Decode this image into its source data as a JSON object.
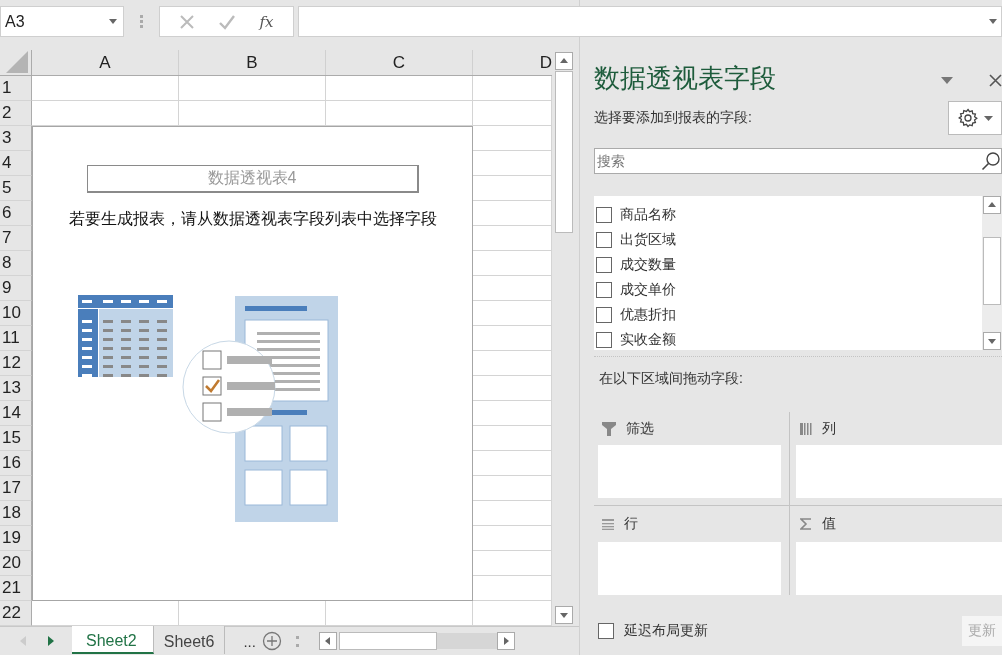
{
  "name_box": {
    "value": "A3"
  },
  "function_button": "fx",
  "columns": [
    "A",
    "B",
    "C",
    "D"
  ],
  "rows": [
    "1",
    "2",
    "3",
    "4",
    "5",
    "6",
    "7",
    "8",
    "9",
    "10",
    "11",
    "12",
    "13",
    "14",
    "15",
    "16",
    "17",
    "18",
    "19",
    "20",
    "21",
    "22"
  ],
  "pivot_placeholder": {
    "title": "数据透视表4",
    "instruction": "若要生成报表，请从数据透视表字段列表中选择字段"
  },
  "sheet_tabs": [
    {
      "label": "Sheet2",
      "selected": true
    },
    {
      "label": "Sheet6",
      "selected": false
    }
  ],
  "more_sheets": "...",
  "field_pane": {
    "title": "数据透视表字段",
    "prompt": "选择要添加到报表的字段:",
    "search": {
      "placeholder": "搜索"
    },
    "fields": [
      {
        "label": "商品名称",
        "checked": false
      },
      {
        "label": "出货区域",
        "checked": false
      },
      {
        "label": "成交数量",
        "checked": false
      },
      {
        "label": "成交单价",
        "checked": false
      },
      {
        "label": "优惠折扣",
        "checked": false
      },
      {
        "label": "实收金额",
        "checked": false
      }
    ],
    "areas_label": "在以下区域间拖动字段:",
    "areas": [
      {
        "kind": "filter",
        "label": "筛选"
      },
      {
        "kind": "columns",
        "label": "列"
      },
      {
        "kind": "rows",
        "label": "行"
      },
      {
        "kind": "values",
        "label": "值"
      }
    ],
    "defer": {
      "label": "延迟布局更新",
      "checked": false
    },
    "update_button": {
      "label": "更新",
      "disabled": true
    }
  }
}
